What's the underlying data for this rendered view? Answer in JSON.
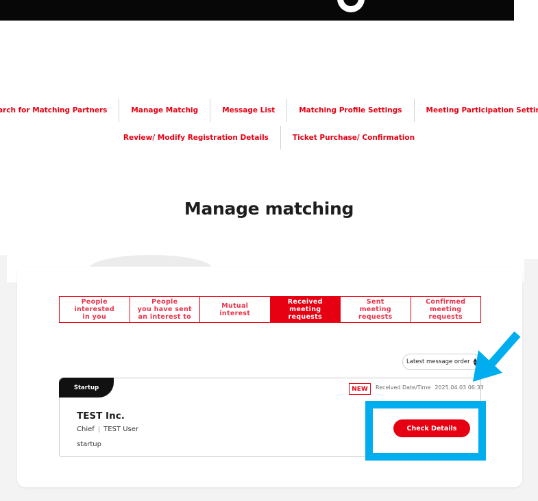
{
  "nav": {
    "row1": [
      "Search for Matching Partners",
      "Manage Matchig",
      "Message List",
      "Matching Profile Settings",
      "Meeting Participation Settings"
    ],
    "row2": [
      "Review/ Modify Registration Details",
      "Ticket Purchase/ Confirmation"
    ]
  },
  "page_title": "Manage matching",
  "tabs": [
    {
      "label": "People\ninterested\nin you",
      "active": false
    },
    {
      "label": "People\nyou have sent\nan interest to",
      "active": false
    },
    {
      "label": "Mutual\ninterest",
      "active": false
    },
    {
      "label": "Received\nmeeting\nrequests",
      "active": true
    },
    {
      "label": "Sent\nmeeting\nrequests",
      "active": false
    },
    {
      "label": "Confirmed\nmeeting\nrequests",
      "active": false
    }
  ],
  "sort": {
    "selected": "Latest message order"
  },
  "card": {
    "tag": "Startup",
    "badge": "NEW",
    "received_label": "Received Date/Time",
    "received_value": "2025.04.03 06:33",
    "company": "TEST Inc.",
    "role": "Chief",
    "person_name": "TEST User",
    "category": "startup",
    "button_label": "Check Details"
  },
  "colors": {
    "accent": "#e60012",
    "annotation": "#00aeef"
  }
}
